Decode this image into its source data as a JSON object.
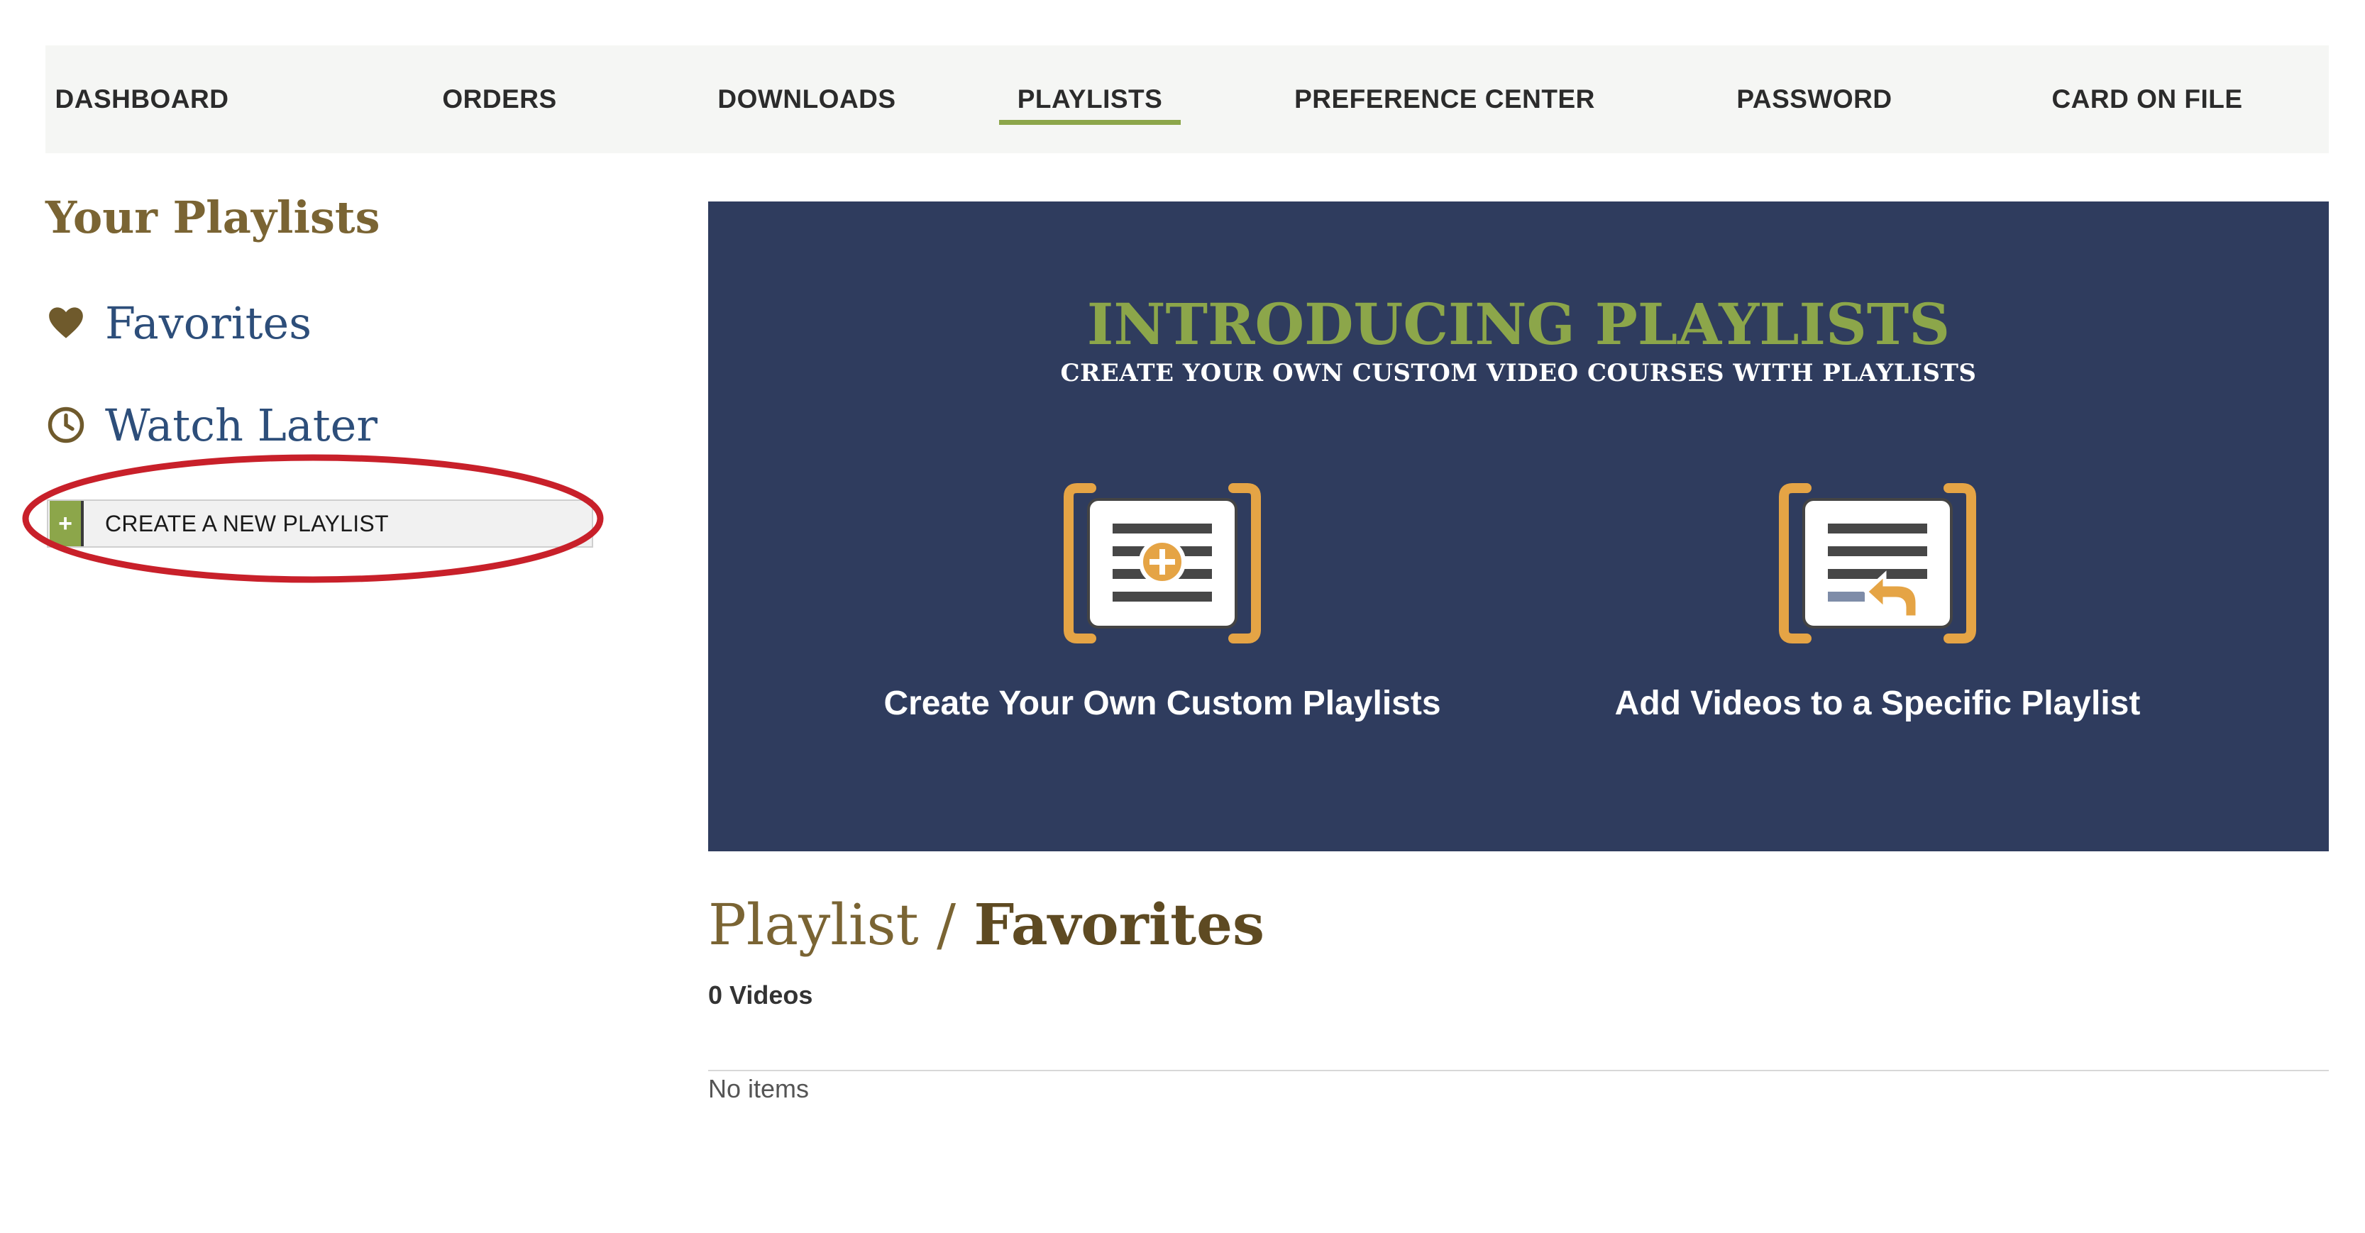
{
  "nav": {
    "items": [
      {
        "label": "DASHBOARD",
        "active": false
      },
      {
        "label": "ORDERS",
        "active": false
      },
      {
        "label": "DOWNLOADS",
        "active": false
      },
      {
        "label": "PLAYLISTS",
        "active": true
      },
      {
        "label": "PREFERENCE CENTER",
        "active": false
      },
      {
        "label": "PASSWORD",
        "active": false
      },
      {
        "label": "CARD ON FILE",
        "active": false
      }
    ]
  },
  "sidebar": {
    "title": "Your Playlists",
    "links": [
      {
        "label": "Favorites",
        "icon": "heart-icon"
      },
      {
        "label": "Watch Later",
        "icon": "clock-icon"
      }
    ],
    "create_button": {
      "label": "CREATE A NEW PLAYLIST",
      "icon": "+"
    }
  },
  "banner": {
    "title": "INTRODUCING PLAYLISTS",
    "subtitle": "CREATE YOUR OWN CUSTOM VIDEO COURSES WITH PLAYLISTS",
    "features": [
      {
        "label": "Create Your Own Custom Playlists",
        "icon": "playlist-add-icon"
      },
      {
        "label": "Add Videos to a Specific Playlist",
        "icon": "playlist-insert-icon"
      }
    ]
  },
  "playlist": {
    "prefix": "Playlist /",
    "name": "Favorites",
    "count": "0 Videos",
    "empty_text": "No items"
  },
  "colors": {
    "accent_green": "#8ca64a",
    "banner_navy": "#2f3c5e",
    "gold_icon": "#e5a445",
    "heading_brown": "#7a6433",
    "link_blue": "#2d4e7a",
    "annotation_red": "#c8202a"
  }
}
